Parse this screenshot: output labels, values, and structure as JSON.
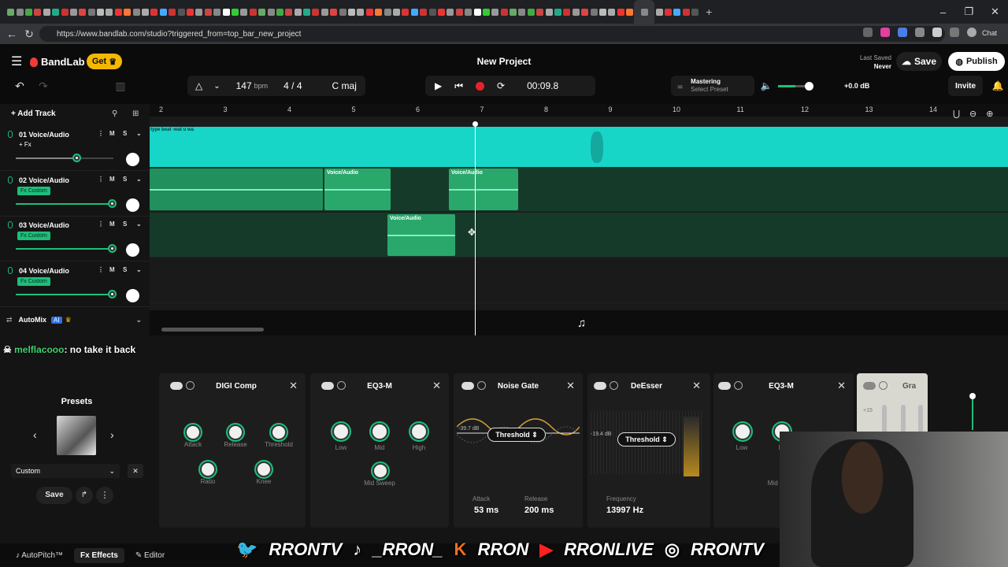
{
  "browser": {
    "url": "https://www.bandlab.com/studio?triggered_from=top_bar_new_project",
    "tabs_count": 76,
    "extension_label": "Chat"
  },
  "app": {
    "logo": "BandLab",
    "get_label": "Get",
    "project_title": "New Project",
    "last_saved_label": "Last Saved",
    "last_saved_value": "Never",
    "save_label": "Save",
    "publish_label": "Publish"
  },
  "transport": {
    "bpm_value": "147",
    "bpm_unit": "bpm",
    "time_signature": "4 / 4",
    "key": "C maj",
    "time": "00:09.8",
    "mastering_title": "Mastering",
    "mastering_sub": "Select Preset",
    "volume_db": "+0.0 dB",
    "invite_label": "Invite"
  },
  "timeline": {
    "add_track_label": "Add Track",
    "bar_numbers": [
      "2",
      "3",
      "4",
      "5",
      "6",
      "7",
      "8",
      "9",
      "10",
      "11",
      "12",
      "13",
      "14"
    ],
    "automix_label": "AutoMix",
    "automix_badge": "AI"
  },
  "tracks": [
    {
      "name": "01 Voice/Audio",
      "fx": "+ Fx",
      "fx_custom": false,
      "volume": 0.62
    },
    {
      "name": "02 Voice/Audio",
      "fx": "Fx Custom",
      "fx_custom": true,
      "volume": 0.98
    },
    {
      "name": "03 Voice/Audio",
      "fx": "Fx Custom",
      "fx_custom": true,
      "volume": 0.98
    },
    {
      "name": "04 Voice/Audio",
      "fx": "Fx Custom",
      "fx_custom": true,
      "volume": 0.98
    }
  ],
  "clips": {
    "track1_title": "type beat -wat u wa",
    "clip_label": "Voice/Audio"
  },
  "chat": {
    "user": "melflacooo",
    "message": ": no take it back"
  },
  "presets": {
    "title": "Presets",
    "selected": "Custom",
    "save_label": "Save"
  },
  "effects": {
    "digi_comp": {
      "title": "DIGI Comp",
      "knobs": [
        "Attack",
        "Release",
        "Threshold",
        "Ratio",
        "Knee"
      ]
    },
    "eq3m_1": {
      "title": "EQ3-M",
      "knobs": [
        "Low",
        "Mid",
        "High",
        "Mid Sweep"
      ]
    },
    "noise_gate": {
      "title": "Noise Gate",
      "db_value": "-39.7 dB",
      "threshold_label": "Threshold",
      "attack_label": "Attack",
      "attack_value": "53 ms",
      "release_label": "Release",
      "release_value": "200 ms"
    },
    "deesser": {
      "title": "DeEsser",
      "db_value": "-19.4 dB",
      "threshold_label": "Threshold",
      "frequency_label": "Frequency",
      "frequency_value": "13997 Hz"
    },
    "eq3m_2": {
      "title": "EQ3-M",
      "knobs": [
        "Low",
        "M",
        "Mid S"
      ]
    },
    "graphic": {
      "title": "Gra",
      "level": "+15"
    }
  },
  "bottom": {
    "autopitch_label": "AutoPitch™",
    "effects_label": "Effects",
    "editor_label": "Editor"
  },
  "overlay": {
    "handles": [
      "RRONTV",
      "_RRON_",
      "RRON",
      "RRONLIVE",
      "RRONTV"
    ]
  },
  "colors": {
    "accent": "#1bbf7a",
    "track1_wave": "#17d6c8",
    "record": "#e8222c",
    "get_button": "#f5b800"
  }
}
